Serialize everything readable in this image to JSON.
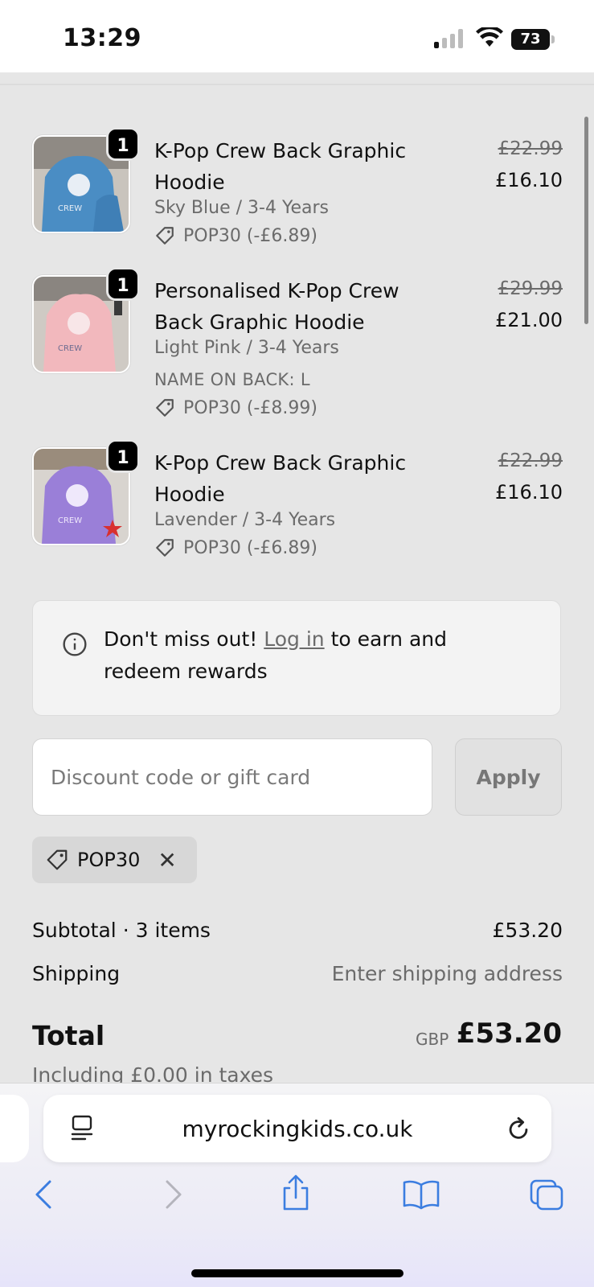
{
  "status_bar": {
    "time": "13:29",
    "battery": "73"
  },
  "items": [
    {
      "quantity": "1",
      "title": "K-Pop Crew Back Graphic Hoodie",
      "variant": "Sky Blue / 3-4 Years",
      "extra": "",
      "discount": "POP30 (-£6.89)",
      "price_original": "£22.99",
      "price_final": "£16.10",
      "thumb_color": "#4a8dc4"
    },
    {
      "quantity": "1",
      "title": "Personalised K-Pop Crew Back Graphic Hoodie",
      "variant": "Light Pink / 3-4 Years",
      "extra": "NAME ON BACK: L",
      "discount": "POP30 (-£8.99)",
      "price_original": "£29.99",
      "price_final": "£21.00",
      "thumb_color": "#f2b8bd"
    },
    {
      "quantity": "1",
      "title": "K-Pop Crew Back Graphic Hoodie",
      "variant": "Lavender / 3-4 Years",
      "extra": "",
      "discount": "POP30 (-£6.89)",
      "price_original": "£22.99",
      "price_final": "£16.10",
      "thumb_color": "#9a7fd8"
    }
  ],
  "rewards": {
    "prefix": "Don't miss out!",
    "link": "Log in",
    "suffix": "to earn and redeem rewards"
  },
  "discount": {
    "placeholder": "Discount code or gift card",
    "apply_label": "Apply",
    "applied_code": "POP30"
  },
  "summary": {
    "subtotal_label": "Subtotal · 3 items",
    "subtotal_value": "£53.20",
    "shipping_label": "Shipping",
    "shipping_value": "Enter shipping address",
    "total_label": "Total",
    "total_currency": "GBP",
    "total_value": "£53.20",
    "taxes": "Including £0.00 in taxes"
  },
  "browser": {
    "url": "myrockingkids.co.uk"
  },
  "colors": {
    "background": "#e6e6e6",
    "ios_blue": "#3b7de0"
  }
}
